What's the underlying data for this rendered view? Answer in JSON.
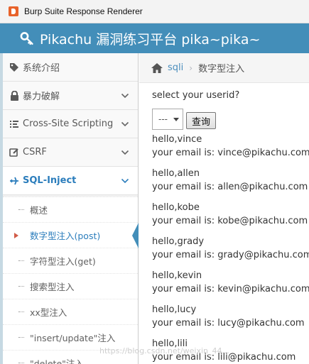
{
  "window": {
    "title": "Burp Suite Response Renderer"
  },
  "header": {
    "brand": "Pikachu 漏洞练习平台 pika~pika~"
  },
  "sidebar": {
    "items": [
      {
        "label": "系统介绍",
        "icon": "tag-icon"
      },
      {
        "label": "暴力破解",
        "icon": "lock-icon"
      },
      {
        "label": "Cross-Site Scripting",
        "icon": "list-icon"
      },
      {
        "label": "CSRF",
        "icon": "edit-icon"
      },
      {
        "label": "SQL-Inject",
        "icon": "plane-icon"
      }
    ],
    "subitems": [
      {
        "label": "概述"
      },
      {
        "label": "数字型注入(post)"
      },
      {
        "label": "字符型注入(get)"
      },
      {
        "label": "搜索型注入"
      },
      {
        "label": "xx型注入"
      },
      {
        "label": "\"insert/update\"注入"
      },
      {
        "label": "\"delete\"注入"
      }
    ]
  },
  "breadcrumb": {
    "link": "sqli",
    "current": "数字型注入"
  },
  "main": {
    "prompt": "select your userid?",
    "select_value": "---",
    "query_button": "查询",
    "results": [
      {
        "hello": "hello,vince",
        "email": "your email is: vince@pikachu.com"
      },
      {
        "hello": "hello,allen",
        "email": "your email is: allen@pikachu.com"
      },
      {
        "hello": "hello,kobe",
        "email": "your email is: kobe@pikachu.com"
      },
      {
        "hello": "hello,grady",
        "email": "your email is: grady@pikachu.com"
      },
      {
        "hello": "hello,kevin",
        "email": "your email is: kevin@pikachu.com"
      },
      {
        "hello": "hello,lucy",
        "email": "your email is: lucy@pikachu.com"
      },
      {
        "hello": "hello,lili",
        "email": "your email is: lili@pikachu.com"
      }
    ]
  },
  "watermark": "https://blog.csdn.net/weixin_44..."
}
